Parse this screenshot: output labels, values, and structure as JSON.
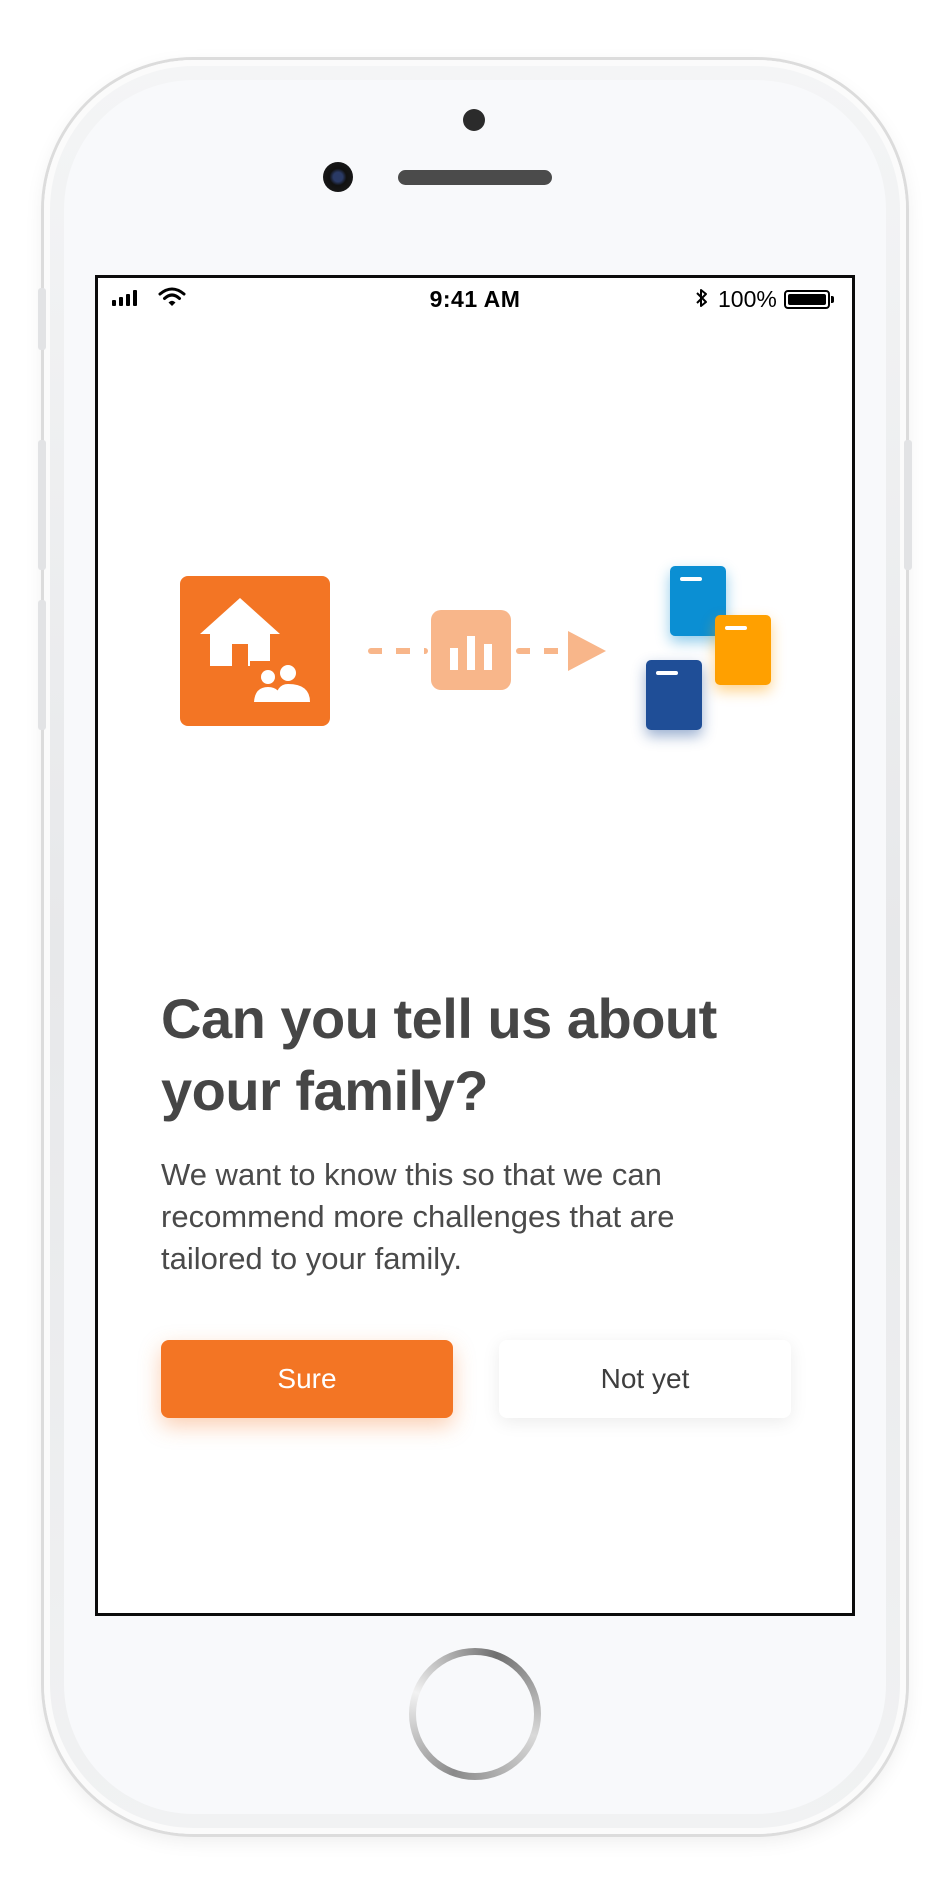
{
  "status_bar": {
    "time": "9:41 AM",
    "battery_percent": "100%",
    "icons": [
      "cellular-signal-icon",
      "wifi-icon",
      "bluetooth-icon",
      "battery-icon"
    ]
  },
  "illustration": {
    "icons": [
      "home-family-icon",
      "bar-chart-icon",
      "arrow-right-icon",
      "challenge-cards-icon"
    ],
    "colors": {
      "primary_orange": "#f37524",
      "light_orange": "#f8b68a",
      "card_light_blue": "#0b8fd3",
      "card_orange": "#ffa000",
      "card_dark_blue": "#1f4e97"
    }
  },
  "content": {
    "title": "Can you tell us about your family?",
    "description": "We want to know this so that we can recommend more challenges that are tailored to your family."
  },
  "actions": {
    "primary_label": "Sure",
    "secondary_label": "Not yet"
  }
}
